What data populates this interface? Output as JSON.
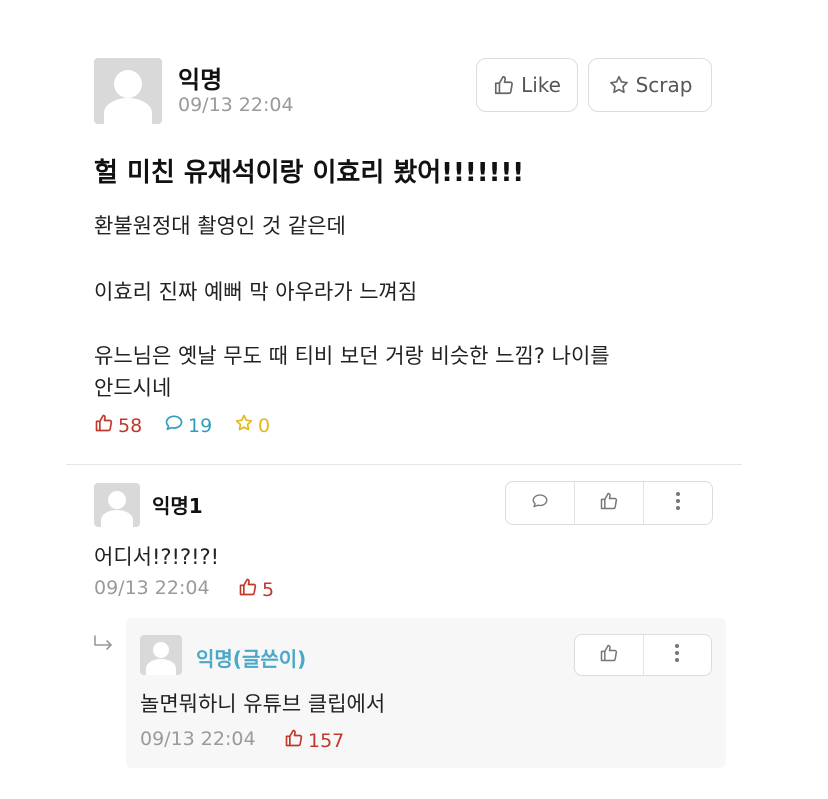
{
  "post": {
    "author": "익명",
    "time": "09/13 22:04",
    "like_label": "Like",
    "scrap_label": "Scrap",
    "title": "헐 미친 유재석이랑 이효리 봤어!!!!!!!",
    "body_lines": [
      "환불원정대 촬영인 것 같은데",
      "이효리 진짜 예뻐 막 아우라가 느껴짐",
      "유느님은 옛날 무도 때 티비 보던 거랑 비슷한 느낌? 나이를",
      "안드시네"
    ],
    "likes": "58",
    "comments": "19",
    "scraps": "0"
  },
  "comment": {
    "author": "익명1",
    "text": "어디서!?!?!?!",
    "time": "09/13 22:04",
    "likes": "5"
  },
  "reply": {
    "author": "익명(글쓴이)",
    "text": "놀면뭐하니 유튜브 클립에서",
    "time": "09/13 22:04",
    "likes": "157"
  },
  "colors": {
    "like": "#c0392b",
    "comment": "#2e9fb8",
    "scrap": "#e2b81a",
    "author_reply": "#4aa8c8",
    "reply_bg": "#f7f7f7"
  }
}
